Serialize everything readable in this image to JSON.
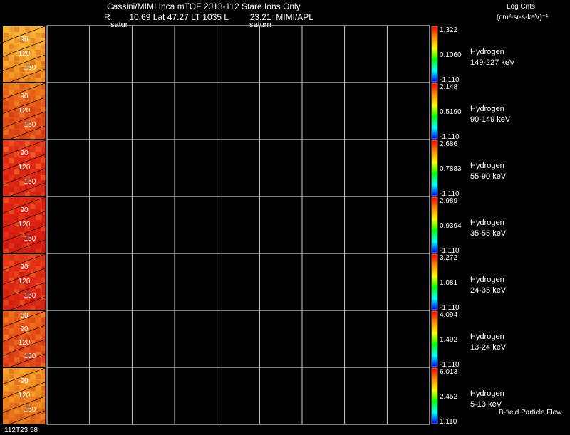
{
  "header": {
    "title": "Cassini/MIMI Inca mTOF  2013-112   Stare   Ions Only",
    "ephemeris": "R        10.69 Lat 47.27 LT 1035 L         23.21  MIMI/APL",
    "unit_title": "Log Cnts",
    "unit_formula": "(cm²-sr-s-keV)⁻¹",
    "label_left": "satur",
    "label_mid": "saturn"
  },
  "time_label": "112T23:58",
  "footnote": "B-field Particle Flow",
  "colors": {
    "background": "#000000",
    "grid": "#ffffff",
    "colorbar_stops": [
      "#0000ff",
      "#00ffff",
      "#00ff00",
      "#ffff00",
      "#ff8800",
      "#ff0000"
    ]
  },
  "chart_data": {
    "type": "heatmap",
    "grid_columns": 9,
    "image_tick_labels": [
      "60",
      "90",
      "120",
      "150"
    ],
    "panels": [
      {
        "species": "Hydrogen",
        "energy": "149-227 keV",
        "cbar_max": "1.322",
        "cbar_mid": "0.1060",
        "cbar_min": "-1.110",
        "image_ticks": [
          "90",
          "120",
          "150"
        ],
        "image_colors": [
          "#f9b63a",
          "#f6a52d",
          "#ef8a1f"
        ]
      },
      {
        "species": "Hydrogen",
        "energy": "90-149 keV",
        "cbar_max": "2.148",
        "cbar_mid": "0.5190",
        "cbar_min": "-1.110",
        "image_ticks": [
          "90",
          "120",
          "150"
        ],
        "image_colors": [
          "#ef7b1c",
          "#e8561a",
          "#e04a18"
        ]
      },
      {
        "species": "Hydrogen",
        "energy": "55-90 keV",
        "cbar_max": "2.686",
        "cbar_mid": "0.7883",
        "cbar_min": "-1.110",
        "image_ticks": [
          "90",
          "120",
          "150"
        ],
        "image_colors": [
          "#ea3a1a",
          "#e52a16",
          "#dc2414"
        ]
      },
      {
        "species": "Hydrogen",
        "energy": "35-55 keV",
        "cbar_max": "2.989",
        "cbar_mid": "0.9394",
        "cbar_min": "-1.110",
        "image_ticks": [
          "90",
          "120",
          "150"
        ],
        "image_colors": [
          "#e82a16",
          "#e02214",
          "#d81e12"
        ]
      },
      {
        "species": "Hydrogen",
        "energy": "24-35 keV",
        "cbar_max": "3.272",
        "cbar_mid": "1.081",
        "cbar_min": "-1.110",
        "image_ticks": [
          "90",
          "120",
          "150"
        ],
        "image_colors": [
          "#ea3a18",
          "#e22c16",
          "#da2614"
        ]
      },
      {
        "species": "Hydrogen",
        "energy": "13-24 keV",
        "cbar_max": "4.094",
        "cbar_mid": "1.492",
        "cbar_min": "-1.110",
        "image_ticks": [
          "60",
          "90",
          "120",
          "150"
        ],
        "image_colors": [
          "#ee6a1c",
          "#e85018",
          "#e04418"
        ]
      },
      {
        "species": "Hydrogen",
        "energy": "5-13 keV",
        "cbar_max": "6.013",
        "cbar_mid": "2.452",
        "cbar_min": "1.110",
        "image_ticks": [
          "90",
          "120",
          "150"
        ],
        "image_colors": [
          "#f9a02a",
          "#f08a22",
          "#e86e1c"
        ]
      }
    ]
  }
}
